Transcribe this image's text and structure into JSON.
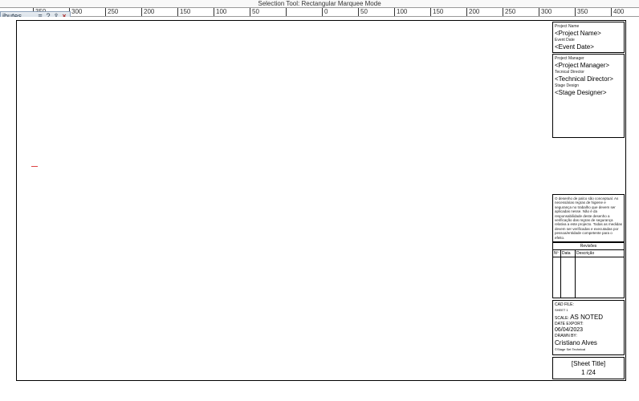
{
  "status": {
    "tool": "Selection Tool: Rectangular Marquee Mode"
  },
  "ruler": {
    "ticks": [
      {
        "pos": 41,
        "label": "350"
      },
      {
        "pos": 86,
        "label": "300"
      },
      {
        "pos": 131,
        "label": "250"
      },
      {
        "pos": 176,
        "label": "200"
      },
      {
        "pos": 221,
        "label": "150"
      },
      {
        "pos": 266,
        "label": "100"
      },
      {
        "pos": 311,
        "label": "50"
      },
      {
        "pos": 356,
        "label": ""
      },
      {
        "pos": 401,
        "label": "0"
      },
      {
        "pos": 446,
        "label": "50"
      },
      {
        "pos": 491,
        "label": "100"
      },
      {
        "pos": 536,
        "label": "150"
      },
      {
        "pos": 581,
        "label": "200"
      },
      {
        "pos": 626,
        "label": "250"
      },
      {
        "pos": 671,
        "label": "300"
      },
      {
        "pos": 716,
        "label": "350"
      },
      {
        "pos": 761,
        "label": "400"
      }
    ]
  },
  "panel": {
    "title": "ibutes"
  },
  "titleblock": {
    "project_name_label": "Project Name",
    "project_name": "<Project Name>",
    "event_date_label": "Event Date",
    "event_date": "<Event Date>",
    "pm_label": "Project Manager",
    "pm": "<Project Manager>",
    "td_label": "Tecnical Director",
    "td": "<Technical Director>",
    "sd_label": "Stage Design",
    "sd": "<Stage Designer>",
    "notes": "O desenho de palco são conceptual. As necessárias regras de higiene e segurança no trabalho que devem ser aplicadas nesse.\nNão é da responsabilidade deste desenho a verificação das regras de segurança relativa a este projecto. Todas as medidas devem ser verificadas e executadas por pessoa/entidade competente para o efeito.",
    "rev_title": "Revisões",
    "rev_h1": "Nº",
    "rev_h2": "Data",
    "rev_h3": "Descrição",
    "cad_label": "CAD FILE:",
    "cad": "SHEET 1",
    "scale_label": "SCALE:",
    "scale": "AS NOTED",
    "export_label": "DATE EXPORT:",
    "export": "06/04/2023",
    "drawn_label": "DRAWN BY:",
    "drawn": "Cristiano Alves",
    "drawn_sub": "©Stage Set Technical",
    "sheet_title": "[Sheet Title]",
    "sheet_num": "1 /24"
  }
}
